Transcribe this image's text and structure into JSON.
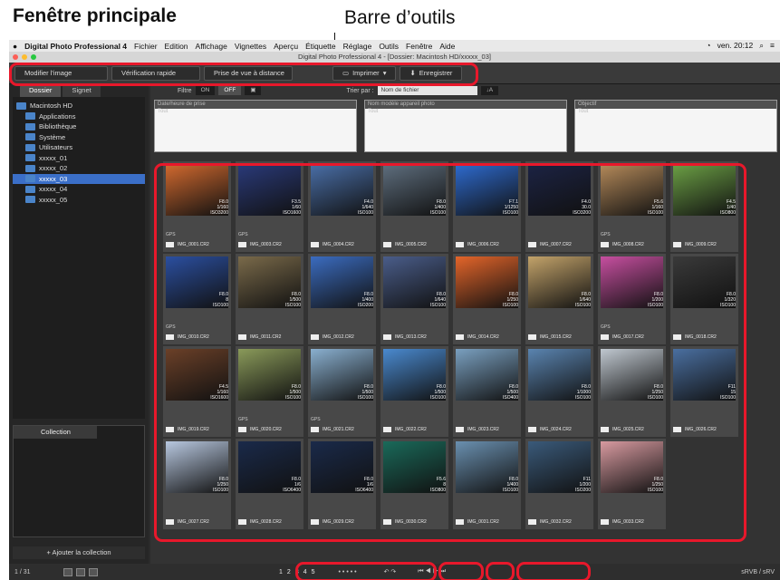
{
  "heading": "Fenêtre principale",
  "callout": "Barre d’outils",
  "menu": {
    "apple": "",
    "app": "Digital Photo Professional 4",
    "items": [
      "Fichier",
      "Edition",
      "Affichage",
      "Vignettes",
      "Aperçu",
      "Étiquette",
      "Réglage",
      "Outils",
      "Fenêtre",
      "Aide"
    ],
    "clock": "ven. 20:12"
  },
  "window_title": "Digital Photo Professional 4 - [Dossier: Macintosh HD/xxxxx_03]",
  "toolbar": {
    "edit": "Modifier l'image",
    "quick": "Vérification rapide",
    "remote": "Prise de vue à distance",
    "print": "Imprimer",
    "save": "Enregistrer"
  },
  "tabs": {
    "folder": "Dossier",
    "bookmark": "Signet"
  },
  "tree": [
    {
      "label": "Macintosh HD",
      "level": 0
    },
    {
      "label": "Applications",
      "level": 1
    },
    {
      "label": "Bibliothèque",
      "level": 1
    },
    {
      "label": "Système",
      "level": 1
    },
    {
      "label": "Utilisateurs",
      "level": 1
    },
    {
      "label": "xxxxx_01",
      "level": 1
    },
    {
      "label": "xxxxx_02",
      "level": 1
    },
    {
      "label": "xxxxx_03",
      "level": 1,
      "selected": true
    },
    {
      "label": "xxxxx_04",
      "level": 1
    },
    {
      "label": "xxxxx_05",
      "level": 1
    }
  ],
  "collection": {
    "title": "Collection",
    "add": "Ajouter la collection"
  },
  "filter": {
    "label": "Filtre",
    "on": "ON",
    "off": "OFF",
    "sort_label": "Trier par :",
    "sort_value": "Nom de fichier"
  },
  "meta_columns": [
    {
      "head": "Date/heure de prise",
      "sub": "Tout"
    },
    {
      "head": "Nom modèle appareil photo",
      "sub": "Tout"
    },
    {
      "head": "Objectif",
      "sub": "Tout"
    }
  ],
  "images": [
    {
      "name": "IMG_0001.CR2",
      "exif": [
        "F8.0",
        "1/160",
        "ISO3200"
      ],
      "gps": true,
      "color": "#d36a2f"
    },
    {
      "name": "IMG_0003.CR2",
      "exif": [
        "F3.5",
        "1/60",
        "ISO1600"
      ],
      "gps": true,
      "color": "#2a3a7a"
    },
    {
      "name": "IMG_0004.CR2",
      "exif": [
        "F4.0",
        "1/640",
        "ISO100"
      ],
      "gps": false,
      "color": "#4a6fa8"
    },
    {
      "name": "IMG_0005.CR2",
      "exif": [
        "F8.0",
        "1/400",
        "ISO100"
      ],
      "gps": false,
      "color": "#5f6f7f"
    },
    {
      "name": "IMG_0006.CR2",
      "exif": [
        "F7.1",
        "1/1250",
        "ISO100"
      ],
      "gps": false,
      "color": "#2e6bd0"
    },
    {
      "name": "IMG_0007.CR2",
      "exif": [
        "F4.0",
        "30.0",
        "ISO3200"
      ],
      "gps": false,
      "color": "#1c2344"
    },
    {
      "name": "IMG_0008.CR2",
      "exif": [
        "F5.6",
        "1/160",
        "ISO100"
      ],
      "gps": true,
      "color": "#b58a5a"
    },
    {
      "name": "IMG_0009.CR2",
      "exif": [
        "F4.5",
        "1/40",
        "ISO800"
      ],
      "gps": false,
      "color": "#6ca045"
    },
    {
      "name": "IMG_0010.CR2",
      "exif": [
        "F8.0",
        "8",
        "ISO100"
      ],
      "gps": true,
      "color": "#2b4fa0"
    },
    {
      "name": "IMG_0011.CR2",
      "exif": [
        "F8.0",
        "1/500",
        "ISO100"
      ],
      "gps": false,
      "color": "#7a6a4a"
    },
    {
      "name": "IMG_0012.CR2",
      "exif": [
        "F8.0",
        "1/400",
        "ISO200"
      ],
      "gps": false,
      "color": "#3b6cc0"
    },
    {
      "name": "IMG_0013.CR2",
      "exif": [
        "F8.0",
        "1/640",
        "ISO100"
      ],
      "gps": false,
      "color": "#4a5d8a"
    },
    {
      "name": "IMG_0014.CR2",
      "exif": [
        "F8.0",
        "1/250",
        "ISO100"
      ],
      "gps": false,
      "color": "#e4652a"
    },
    {
      "name": "IMG_0015.CR2",
      "exif": [
        "F8.0",
        "1/640",
        "ISO100"
      ],
      "gps": false,
      "color": "#c3a36a"
    },
    {
      "name": "IMG_0017.CR2",
      "exif": [
        "F8.0",
        "1/200",
        "ISO100"
      ],
      "gps": true,
      "color": "#c74fa0"
    },
    {
      "name": "IMG_0018.CR2",
      "exif": [
        "F8.0",
        "1/320",
        "ISO100"
      ],
      "gps": false,
      "color": "#3a3a3a"
    },
    {
      "name": "IMG_0019.CR2",
      "exif": [
        "F4.5",
        "1/160",
        "ISO1600"
      ],
      "gps": false,
      "color": "#6b4028"
    },
    {
      "name": "IMG_0020.CR2",
      "exif": [
        "F8.0",
        "1/500",
        "ISO100"
      ],
      "gps": true,
      "color": "#8a9a5a"
    },
    {
      "name": "IMG_0021.CR2",
      "exif": [
        "F8.0",
        "1/500",
        "ISO100"
      ],
      "gps": true,
      "color": "#8ab0d0"
    },
    {
      "name": "IMG_0022.CR2",
      "exif": [
        "F8.0",
        "1/500",
        "ISO100"
      ],
      "gps": false,
      "color": "#4a8ad0"
    },
    {
      "name": "IMG_0023.CR2",
      "exif": [
        "F8.0",
        "1/500",
        "ISO400"
      ],
      "gps": false,
      "color": "#7aa0c0"
    },
    {
      "name": "IMG_0024.CR2",
      "exif": [
        "F8.0",
        "1/1000",
        "ISO100"
      ],
      "gps": false,
      "color": "#5a84b0"
    },
    {
      "name": "IMG_0025.CR2",
      "exif": [
        "F8.0",
        "1/250",
        "ISO100"
      ],
      "gps": false,
      "color": "#c0c8d0"
    },
    {
      "name": "IMG_0026.CR2",
      "exif": [
        "F11",
        "15",
        "ISO100"
      ],
      "gps": false,
      "color": "#4a6fa0"
    },
    {
      "name": "IMG_0027.CR2",
      "exif": [
        "F8.0",
        "1/250",
        "ISO100"
      ],
      "gps": false,
      "color": "#b8c8e0"
    },
    {
      "name": "IMG_0028.CR2",
      "exif": [
        "F8.0",
        "1/6",
        "ISO6400"
      ],
      "gps": false,
      "color": "#1a2a4a"
    },
    {
      "name": "IMG_0029.CR2",
      "exif": [
        "F8.0",
        "1/6",
        "ISO6400"
      ],
      "gps": false,
      "color": "#1a2a4a"
    },
    {
      "name": "IMG_0030.CR2",
      "exif": [
        "F5.6",
        "8",
        "ISO800"
      ],
      "gps": false,
      "color": "#1a6a5a"
    },
    {
      "name": "IMG_0031.CR2",
      "exif": [
        "F8.0",
        "1/400",
        "ISO100"
      ],
      "gps": false,
      "color": "#6a90b0"
    },
    {
      "name": "IMG_0032.CR2",
      "exif": [
        "F11",
        "1/200",
        "ISO200"
      ],
      "gps": false,
      "color": "#3a5a7a"
    },
    {
      "name": "IMG_0033.CR2",
      "exif": [
        "F8.0",
        "1/250",
        "ISO100"
      ],
      "gps": false,
      "color": "#d89aa0"
    }
  ],
  "status": {
    "count": "1 / 31",
    "colorspace": "sRVB / sRV"
  },
  "ratings": [
    "1",
    "2",
    "3",
    "4",
    "5"
  ]
}
